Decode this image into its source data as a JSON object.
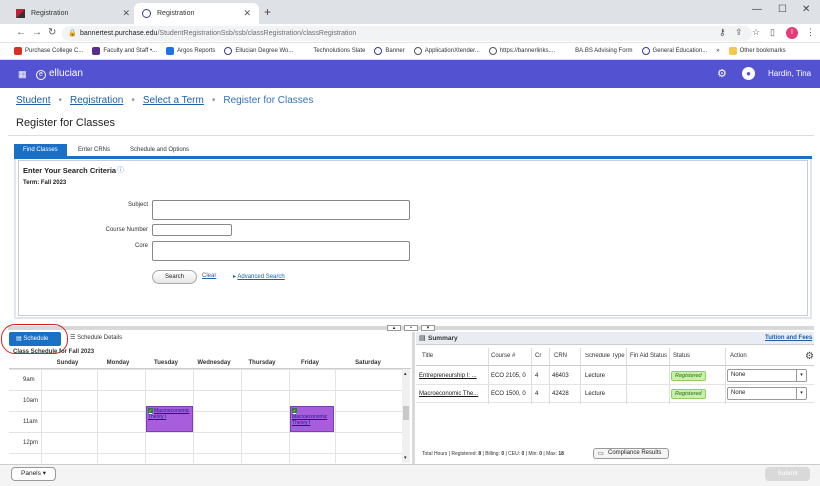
{
  "browser": {
    "tabs": [
      {
        "title": "Registration",
        "active": false
      },
      {
        "title": "Registration",
        "active": true
      }
    ],
    "new_tab": "+",
    "window_controls": {
      "minimize": "—",
      "maximize": "☐",
      "close": "✕"
    },
    "url_domain": "bannertest.purchase.edu",
    "url_path": "/StudentRegistrationSsb/ssb/classRegistration/classRegistration",
    "profile_initial": "I",
    "bookmarks": [
      {
        "label": "Purchase College C...",
        "color": "#d93025"
      },
      {
        "label": "Faculty and Staff •...",
        "color": "#5b2c8b"
      },
      {
        "label": "Argos Reports",
        "color": "#1a73e8"
      },
      {
        "label": "Ellucian Degree Wo...",
        "color": "#3a3a8c"
      },
      {
        "label": "Technolutions Slate",
        "color": "#ffffff"
      },
      {
        "label": "Banner",
        "color": "#3a3a8c"
      },
      {
        "label": "ApplicationXtender...",
        "color": "#555555"
      },
      {
        "label": "https://bannerlinks....",
        "color": "#555555"
      },
      {
        "label": "BA.BS Advising Form",
        "color": "#ffffff"
      },
      {
        "label": "General Education...",
        "color": "#3a3a8c"
      }
    ],
    "more_bookmarks": "»",
    "other_bookmarks": "Other bookmarks"
  },
  "app": {
    "brand": "ellucian",
    "user_name": "Hardin, Tina",
    "header_color": "#5353d1"
  },
  "breadcrumbs": [
    "Student",
    "Registration",
    "Select a Term",
    "Register for Classes"
  ],
  "page_title": "Register for Classes",
  "inner_tabs": [
    {
      "label": "Find Classes",
      "active": true
    },
    {
      "label": "Enter CRNs",
      "active": false
    },
    {
      "label": "Schedule and Options",
      "active": false
    }
  ],
  "search": {
    "heading": "Enter Your Search Criteria",
    "term": "Term: Fall 2023",
    "fields": [
      {
        "label": "Subject",
        "value": ""
      },
      {
        "label": "Course Number",
        "value": ""
      },
      {
        "label": "Core",
        "value": ""
      }
    ],
    "search_button": "Search",
    "clear_link": "Clear",
    "advanced_prefix": "▸",
    "advanced_link": "Advanced Search"
  },
  "schedule": {
    "tab_label": "Schedule",
    "details_label": "Schedule Details",
    "title": "Class Schedule for Fall 2023",
    "days": [
      "Sunday",
      "Monday",
      "Tuesday",
      "Wednesday",
      "Thursday",
      "Friday",
      "Saturday"
    ],
    "hours": [
      "9am",
      "10am",
      "11am",
      "12pm"
    ],
    "events": [
      {
        "day": "Tuesday",
        "title": "Macroeconomic Theory I",
        "start_hour": 10.75,
        "end_hour": 12.0
      },
      {
        "day": "Friday",
        "title": "Macroeconomic Theory I",
        "start_hour": 10.75,
        "end_hour": 12.0
      }
    ]
  },
  "summary": {
    "title": "Summary",
    "tuition_link": "Tuition and Fees",
    "columns": [
      "Title",
      "Course #",
      "Cr",
      "CRN",
      "Schedule Type",
      "Fin Aid Status",
      "Status",
      "Action"
    ],
    "rows": [
      {
        "title": "Entrepreneurship I: ...",
        "course": "ECO 2105, 0",
        "credits": "4",
        "crn": "46403",
        "schedule_type": "Lecture",
        "fin_aid": "",
        "status": "Registered",
        "action": "None"
      },
      {
        "title": "Macroeconomic The...",
        "course": "ECO 1500, 0",
        "credits": "4",
        "crn": "42428",
        "schedule_type": "Lecture",
        "fin_aid": "",
        "status": "Registered",
        "action": "None"
      }
    ],
    "totals": {
      "hours_label": "Total Hours | Registered:",
      "registered": "8",
      "billing_label": "| Billing:",
      "billing": "0",
      "ceu_label": "| CEU:",
      "ceu": "0",
      "min_label": "| Min:",
      "min": "0",
      "max_label": "| Max:",
      "max": "18"
    },
    "compliance_button": "Compliance Results"
  },
  "footer": {
    "panels_label": "Panels",
    "submit_label": "Submit"
  }
}
